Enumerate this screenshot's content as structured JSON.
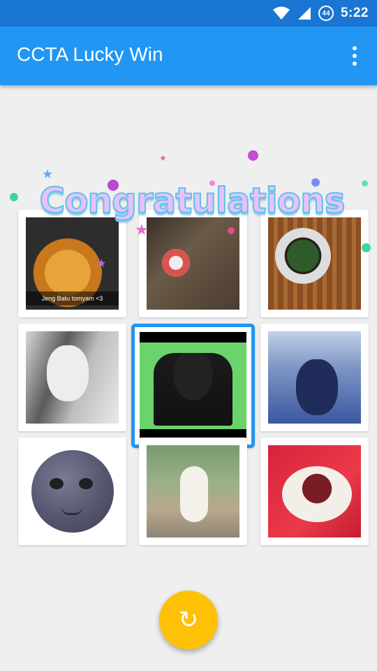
{
  "status_bar": {
    "time": "5:22",
    "battery": "44"
  },
  "app_bar": {
    "title": "CCTA Lucky Win"
  },
  "overlay": {
    "congrats_text": "Congratulations"
  },
  "grid": {
    "cells": [
      {
        "name": "photo-laksa",
        "caption": "Jeng Batu tomyam <3"
      },
      {
        "name": "photo-food-table"
      },
      {
        "name": "photo-soup-bowl"
      },
      {
        "name": "photo-woman-portrait"
      },
      {
        "name": "photo-group",
        "selected": true
      },
      {
        "name": "photo-woman-blue"
      },
      {
        "name": "moon-emoji"
      },
      {
        "name": "photo-woman-sitting"
      },
      {
        "name": "photo-ice-dessert"
      }
    ]
  },
  "fab": {
    "icon": "replay-icon",
    "glyph": "↻"
  },
  "colors": {
    "primary": "#2196f3",
    "primary_dark": "#1976d2",
    "accent": "#ffc107"
  }
}
